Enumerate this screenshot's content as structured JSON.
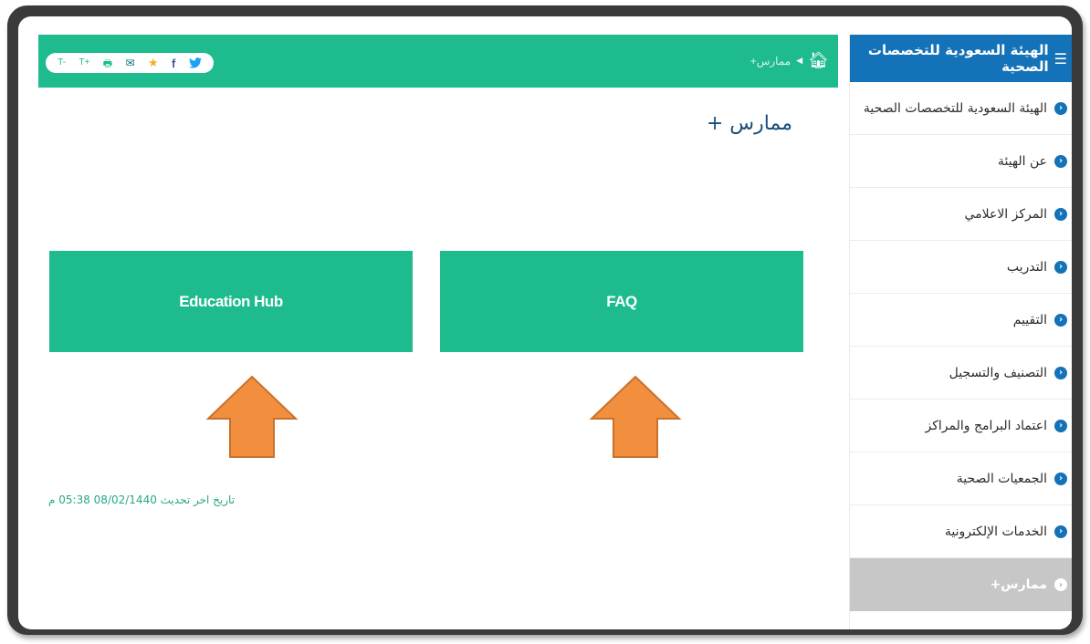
{
  "share_bar": {
    "font_decrease": "T-",
    "font_increase": "T+",
    "print_icon": "print-icon",
    "mail_icon": "mail-icon",
    "favorite_icon": "star-icon",
    "facebook_icon": "facebook-icon",
    "twitter_icon": "twitter-icon"
  },
  "breadcrumb": {
    "home_icon": "home-icon",
    "current": "ممارس+"
  },
  "page": {
    "title": "ممارس +",
    "tiles": [
      {
        "label": "Education Hub"
      },
      {
        "label": "FAQ"
      }
    ],
    "last_update": "تاريخ اخر تحديث 08/02/1440 05:38 م"
  },
  "sidebar": {
    "header": "الهيئة السعودية للتخصصات الصحية",
    "items": [
      {
        "label": "الهيئة السعودية للتخصصات الصحية"
      },
      {
        "label": "عن الهيئة"
      },
      {
        "label": "المركز الاعلامي"
      },
      {
        "label": "التدريب"
      },
      {
        "label": "التقييم"
      },
      {
        "label": "التصنيف والتسجيل"
      },
      {
        "label": "اعتماد البرامج والمراكز"
      },
      {
        "label": "الجمعيات الصحية"
      },
      {
        "label": "الخدمات الإلكترونية"
      },
      {
        "label": "ممارس+"
      }
    ]
  },
  "colors": {
    "accent_green": "#1dbb8e",
    "sidebar_blue": "#1472b8",
    "arrow_orange": "#f18f3f",
    "active_gray": "#c7c7c7"
  }
}
